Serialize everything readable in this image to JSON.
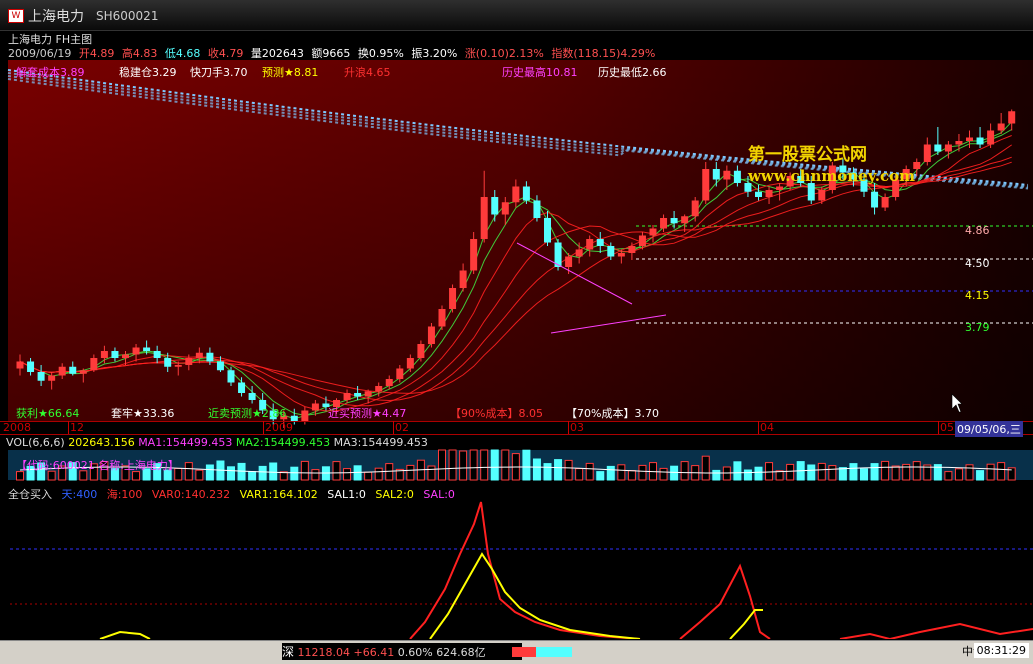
{
  "window": {
    "title": "上海电力",
    "code": "SH600021"
  },
  "chart_header": {
    "title": "上海电力 FH主图"
  },
  "quote": {
    "date": "2009/06/19",
    "open": "开4.89",
    "high": "高4.83",
    "low": "低4.68",
    "close": "收4.79",
    "volume": "量202643",
    "amount": "额9665",
    "turnover": "换0.95%",
    "amplitude": "振3.20%",
    "change": "涨(0.10)2.13%",
    "index": "指数(118.15)4.29%"
  },
  "indicators_top": [
    {
      "text": "解套成本3.89",
      "color": "#ff40ff"
    },
    {
      "text": "稳建仓3.29",
      "color": "#ffffff"
    },
    {
      "text": "快刀手3.70",
      "color": "#ffffff"
    },
    {
      "text": "预测★8.81",
      "color": "#ffff00"
    },
    {
      "text": "升浪4.65",
      "color": "#ff3030"
    },
    {
      "text": "历史最高10.81",
      "color": "#ff40ff"
    },
    {
      "text": "历史最低2.66",
      "color": "#ffffff"
    }
  ],
  "watermark": {
    "line1": "第一股票公式网",
    "line2": "www.chnmoney.com"
  },
  "price_levels": [
    "4.86",
    "4.50",
    "4.15",
    "3.79"
  ],
  "indicators_bottom": [
    {
      "text": "获利★66.64",
      "color": "#30ff30"
    },
    {
      "text": "套牢★33.36",
      "color": "#ffffff"
    },
    {
      "text": "近卖预测★2.86",
      "color": "#30ff30"
    },
    {
      "text": "近买预测★4.47",
      "color": "#ff40ff"
    },
    {
      "text": "【90%成本】8.05",
      "color": "#ff3030"
    },
    {
      "text": "【70%成本】3.70",
      "color": "#ffffff"
    }
  ],
  "x_axis": {
    "labels": [
      "2008",
      "12",
      "2009",
      "02",
      "03",
      "04",
      "05"
    ],
    "cursor_date": "09/05/06,三"
  },
  "volume_header": {
    "vol": "VOL(6,6,6)",
    "vol_value": "202643.156",
    "ma1": "MA1:154499.453",
    "ma2": "MA2:154499.453",
    "ma3": "MA3:154499.453",
    "info": "【代码:600021 名称:上海电力】"
  },
  "indicator_header": {
    "name": "全仓买入",
    "items": [
      {
        "text": "天:400",
        "color": "#3060ff"
      },
      {
        "text": "海:100",
        "color": "#ff3030"
      },
      {
        "text": "VAR0:140.232",
        "color": "#ff3030"
      },
      {
        "text": "VAR1:164.102",
        "color": "#ffff00"
      },
      {
        "text": "SAL1:0",
        "color": "#ffffff"
      },
      {
        "text": "SAL2:0",
        "color": "#ffff00"
      },
      {
        "text": "SAL:0",
        "color": "#ff40ff"
      }
    ]
  },
  "status": {
    "market": "深",
    "index_value": "11218.04",
    "index_change": "+66.41",
    "index_pct": "0.60%",
    "amount": "624.68亿",
    "time": "08:31:29",
    "extra": "中证"
  },
  "colors": {
    "up": "#ff3b3b",
    "down": "#54ffff",
    "bg_gradient_top": "#8a0000"
  },
  "chart_data": {
    "type": "candlestick",
    "price_range": [
      3.6,
      5.0
    ],
    "last_close": 4.79,
    "candles": [
      [
        3.32,
        3.4,
        3.28,
        3.36
      ],
      [
        3.36,
        3.38,
        3.28,
        3.3
      ],
      [
        3.3,
        3.34,
        3.22,
        3.25
      ],
      [
        3.25,
        3.3,
        3.2,
        3.28
      ],
      [
        3.28,
        3.35,
        3.26,
        3.33
      ],
      [
        3.33,
        3.36,
        3.28,
        3.29
      ],
      [
        3.29,
        3.32,
        3.24,
        3.31
      ],
      [
        3.31,
        3.4,
        3.3,
        3.38
      ],
      [
        3.38,
        3.45,
        3.35,
        3.42
      ],
      [
        3.42,
        3.44,
        3.36,
        3.38
      ],
      [
        3.38,
        3.42,
        3.34,
        3.4
      ],
      [
        3.4,
        3.46,
        3.36,
        3.44
      ],
      [
        3.44,
        3.48,
        3.4,
        3.42
      ],
      [
        3.42,
        3.45,
        3.35,
        3.38
      ],
      [
        3.38,
        3.41,
        3.3,
        3.33
      ],
      [
        3.33,
        3.36,
        3.28,
        3.34
      ],
      [
        3.34,
        3.4,
        3.31,
        3.38
      ],
      [
        3.38,
        3.44,
        3.35,
        3.41
      ],
      [
        3.41,
        3.44,
        3.34,
        3.36
      ],
      [
        3.36,
        3.39,
        3.3,
        3.31
      ],
      [
        3.31,
        3.33,
        3.22,
        3.24
      ],
      [
        3.24,
        3.27,
        3.16,
        3.18
      ],
      [
        3.18,
        3.22,
        3.12,
        3.14
      ],
      [
        3.14,
        3.18,
        3.06,
        3.08
      ],
      [
        3.08,
        3.12,
        3.0,
        3.03
      ],
      [
        3.03,
        3.08,
        2.98,
        3.05
      ],
      [
        3.05,
        3.09,
        3.0,
        3.02
      ],
      [
        3.02,
        3.1,
        3.0,
        3.08
      ],
      [
        3.08,
        3.14,
        3.05,
        3.12
      ],
      [
        3.12,
        3.16,
        3.08,
        3.1
      ],
      [
        3.1,
        3.15,
        3.06,
        3.14
      ],
      [
        3.14,
        3.2,
        3.12,
        3.18
      ],
      [
        3.18,
        3.22,
        3.14,
        3.16
      ],
      [
        3.16,
        3.2,
        3.12,
        3.19
      ],
      [
        3.19,
        3.24,
        3.16,
        3.22
      ],
      [
        3.22,
        3.28,
        3.2,
        3.26
      ],
      [
        3.26,
        3.34,
        3.24,
        3.32
      ],
      [
        3.32,
        3.4,
        3.3,
        3.38
      ],
      [
        3.38,
        3.48,
        3.36,
        3.46
      ],
      [
        3.46,
        3.58,
        3.44,
        3.56
      ],
      [
        3.56,
        3.68,
        3.54,
        3.66
      ],
      [
        3.66,
        3.8,
        3.64,
        3.78
      ],
      [
        3.78,
        3.92,
        3.76,
        3.88
      ],
      [
        3.88,
        4.1,
        3.86,
        4.06
      ],
      [
        4.06,
        4.45,
        4.04,
        4.3
      ],
      [
        4.3,
        4.34,
        4.16,
        4.2
      ],
      [
        4.2,
        4.3,
        4.14,
        4.27
      ],
      [
        4.27,
        4.4,
        4.24,
        4.36
      ],
      [
        4.36,
        4.39,
        4.26,
        4.28
      ],
      [
        4.28,
        4.31,
        4.16,
        4.18
      ],
      [
        4.18,
        4.22,
        4.02,
        4.04
      ],
      [
        4.04,
        4.06,
        3.88,
        3.9
      ],
      [
        3.9,
        3.98,
        3.86,
        3.96
      ],
      [
        3.96,
        4.04,
        3.92,
        4.0
      ],
      [
        4.0,
        4.08,
        3.96,
        4.06
      ],
      [
        4.06,
        4.1,
        3.98,
        4.02
      ],
      [
        4.02,
        4.04,
        3.94,
        3.96
      ],
      [
        3.96,
        4.0,
        3.92,
        3.98
      ],
      [
        3.98,
        4.04,
        3.94,
        4.02
      ],
      [
        4.02,
        4.1,
        4.0,
        4.08
      ],
      [
        4.08,
        4.14,
        4.04,
        4.12
      ],
      [
        4.12,
        4.2,
        4.1,
        4.18
      ],
      [
        4.18,
        4.22,
        4.12,
        4.15
      ],
      [
        4.15,
        4.2,
        4.1,
        4.19
      ],
      [
        4.19,
        4.3,
        4.16,
        4.28
      ],
      [
        4.28,
        4.5,
        4.26,
        4.46
      ],
      [
        4.46,
        4.5,
        4.36,
        4.4
      ],
      [
        4.4,
        4.48,
        4.34,
        4.45
      ],
      [
        4.45,
        4.48,
        4.36,
        4.38
      ],
      [
        4.38,
        4.42,
        4.3,
        4.33
      ],
      [
        4.33,
        4.37,
        4.28,
        4.3
      ],
      [
        4.3,
        4.36,
        4.26,
        4.34
      ],
      [
        4.34,
        4.38,
        4.28,
        4.36
      ],
      [
        4.36,
        4.44,
        4.34,
        4.42
      ],
      [
        4.42,
        4.46,
        4.36,
        4.38
      ],
      [
        4.38,
        4.42,
        4.26,
        4.28
      ],
      [
        4.28,
        4.36,
        4.26,
        4.34
      ],
      [
        4.34,
        4.5,
        4.32,
        4.48
      ],
      [
        4.48,
        4.52,
        4.4,
        4.44
      ],
      [
        4.44,
        4.47,
        4.36,
        4.4
      ],
      [
        4.4,
        4.44,
        4.3,
        4.33
      ],
      [
        4.33,
        4.38,
        4.2,
        4.24
      ],
      [
        4.24,
        4.32,
        4.22,
        4.3
      ],
      [
        4.3,
        4.42,
        4.28,
        4.4
      ],
      [
        4.4,
        4.48,
        4.36,
        4.46
      ],
      [
        4.46,
        4.52,
        4.42,
        4.5
      ],
      [
        4.5,
        4.64,
        4.48,
        4.6
      ],
      [
        4.6,
        4.7,
        4.54,
        4.56
      ],
      [
        4.56,
        4.62,
        4.52,
        4.6
      ],
      [
        4.6,
        4.66,
        4.56,
        4.62
      ],
      [
        4.62,
        4.68,
        4.58,
        4.64
      ],
      [
        4.64,
        4.7,
        4.58,
        4.6
      ],
      [
        4.6,
        4.72,
        4.58,
        4.68
      ],
      [
        4.68,
        4.78,
        4.66,
        4.72
      ],
      [
        4.72,
        4.8,
        4.68,
        4.79
      ]
    ]
  }
}
